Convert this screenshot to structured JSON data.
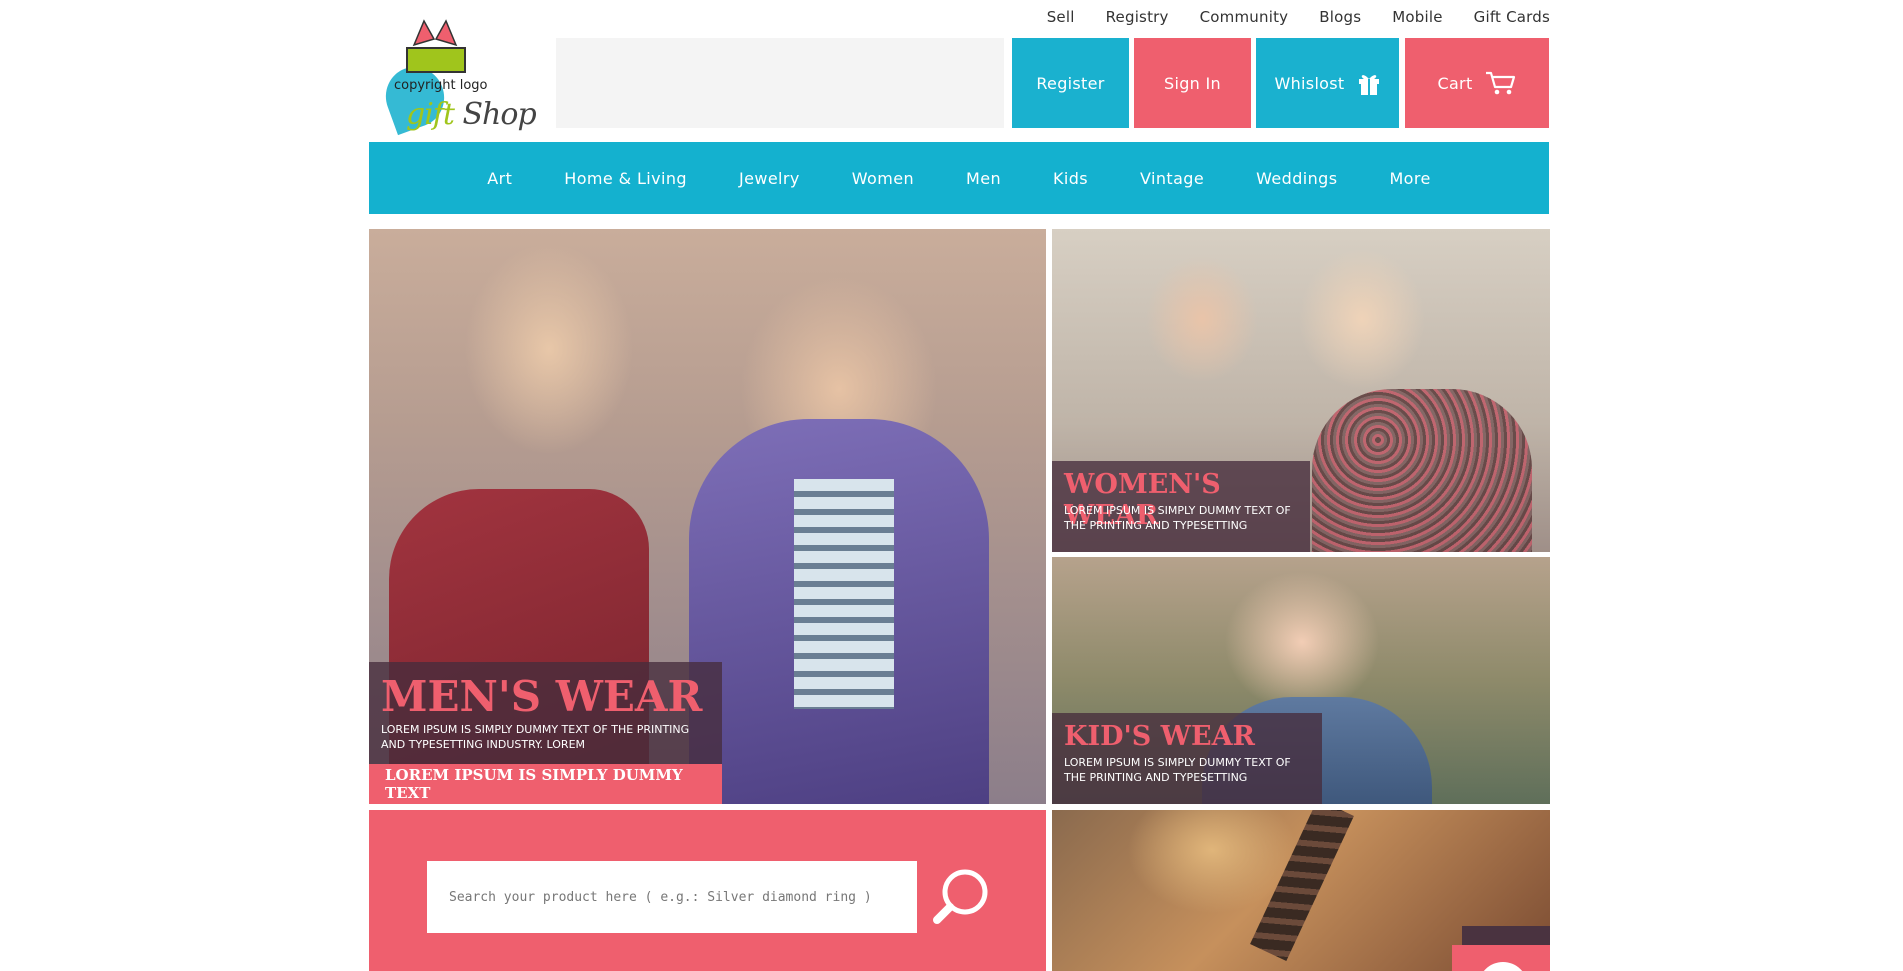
{
  "top_links": [
    "Sell",
    "Registry",
    "Community",
    "Blogs",
    "Mobile",
    "Gift Cards"
  ],
  "logo": {
    "caption": "copyright logo",
    "script_gift": "gift",
    "script_shop": " Shop"
  },
  "header": {
    "register": "Register",
    "signin": "Sign In",
    "wishlist": "Whislost",
    "cart": "Cart"
  },
  "nav": [
    "Art",
    "Home & Living",
    "Jewelry",
    "Women",
    "Men",
    "Kids",
    "Vintage",
    "Weddings",
    "More"
  ],
  "tiles": {
    "men": {
      "title": "MEN'S WEAR",
      "text": "LOREM IPSUM IS SIMPLY DUMMY TEXT OF THE PRINTING AND TYPESETTING INDUSTRY. LOREM",
      "cta": "LOREM IPSUM IS SIMPLY DUMMY TEXT"
    },
    "women": {
      "title": "WOMEN'S WEAR",
      "text": "LOREM IPSUM IS SIMPLY DUMMY TEXT OF THE PRINTING AND TYPESETTING"
    },
    "kids": {
      "title": "KID'S WEAR",
      "text": "LOREM IPSUM IS SIMPLY DUMMY TEXT OF THE PRINTING AND TYPESETTING"
    }
  },
  "search": {
    "placeholder": "Search your product here ( e.g.: Silver diamond ring )"
  },
  "colors": {
    "teal": "#1ab1cf",
    "pink": "#ef5f6e",
    "caption_bg": "#462d3c"
  },
  "icons": {
    "wishlist": "gift-icon",
    "cart": "cart-icon",
    "search": "magnifier-icon",
    "next": "chevron-right-icon"
  }
}
